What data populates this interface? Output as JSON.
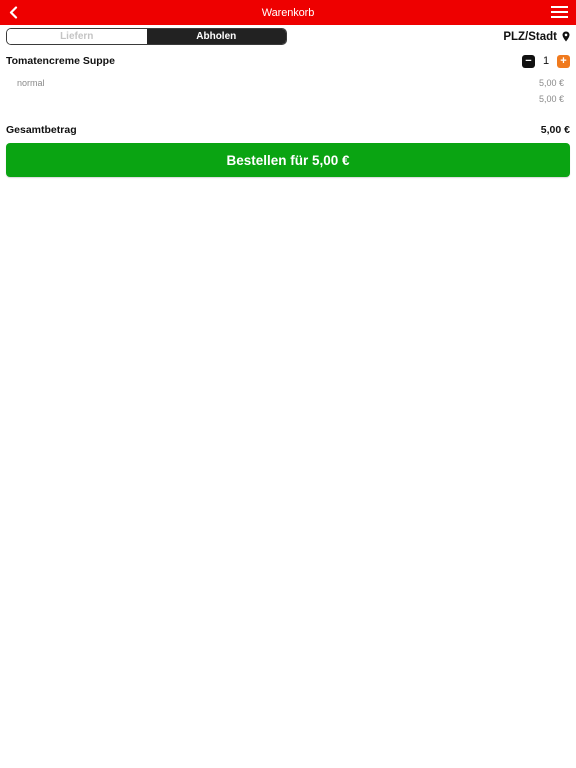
{
  "header": {
    "title": "Warenkorb"
  },
  "icons": {
    "back": "chevron-left-icon",
    "menu": "hamburger-menu-icon",
    "location": "map-pin-icon",
    "minus": "minus-icon",
    "plus": "plus-icon"
  },
  "mode_toggle": {
    "options": [
      "Liefern",
      "Abholen"
    ],
    "selected": "Abholen"
  },
  "location": {
    "label": "PLZ/Stadt"
  },
  "cart": {
    "items": [
      {
        "name": "Tomatencreme Suppe",
        "quantity": "1",
        "minus_label": "−",
        "plus_label": "+",
        "variant": "normal",
        "variant_price": "5,00 €",
        "line_total": "5,00 €"
      }
    ],
    "total_label": "Gesamtbetrag",
    "total_value": "5,00 €"
  },
  "order_button": {
    "label": "Bestellen für 5,00 €"
  },
  "colors": {
    "header": "#ee0000",
    "order_button": "#0aa412",
    "plus_button": "#f07a1e",
    "toggle_active": "#222222"
  }
}
